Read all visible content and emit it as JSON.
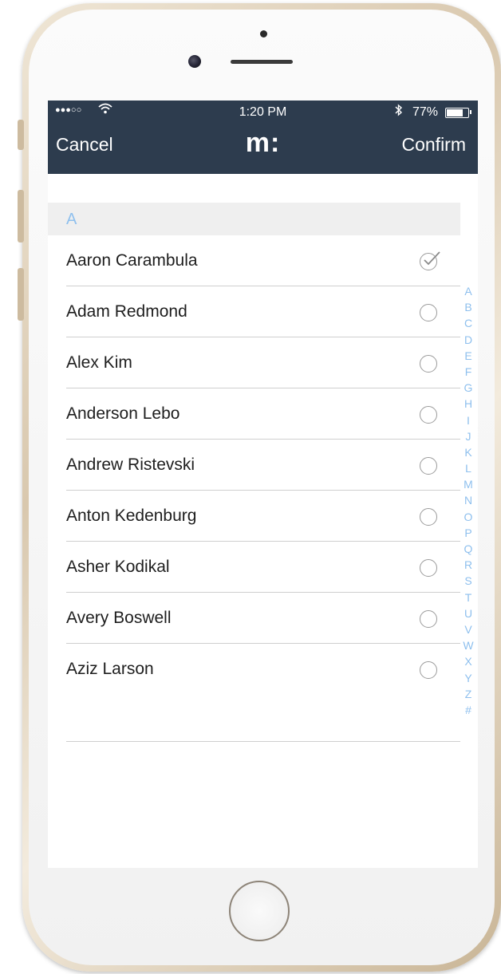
{
  "status_bar": {
    "signal": "●●●○○",
    "time": "1:20 PM",
    "battery_pct": "77%",
    "battery_level": 0.77
  },
  "nav": {
    "cancel": "Cancel",
    "logo": "m:",
    "confirm": "Confirm"
  },
  "section_header": "A",
  "contacts": [
    {
      "name": "Aaron Carambula",
      "selected": true
    },
    {
      "name": "Adam Redmond",
      "selected": false
    },
    {
      "name": "Alex Kim",
      "selected": false
    },
    {
      "name": "Anderson Lebo",
      "selected": false
    },
    {
      "name": "Andrew Ristevski",
      "selected": false
    },
    {
      "name": "Anton Kedenburg",
      "selected": false
    },
    {
      "name": "Asher Kodikal",
      "selected": false
    },
    {
      "name": "Avery Boswell",
      "selected": false
    },
    {
      "name": "Aziz Larson",
      "selected": false
    }
  ],
  "alphabet_index": [
    "A",
    "B",
    "C",
    "D",
    "E",
    "F",
    "G",
    "H",
    "I",
    "J",
    "K",
    "L",
    "M",
    "N",
    "O",
    "P",
    "Q",
    "R",
    "S",
    "T",
    "U",
    "V",
    "W",
    "X",
    "Y",
    "Z",
    "#"
  ],
  "colors": {
    "nav_bar": "#2d3c4e",
    "accent": "#8fc0ee"
  }
}
